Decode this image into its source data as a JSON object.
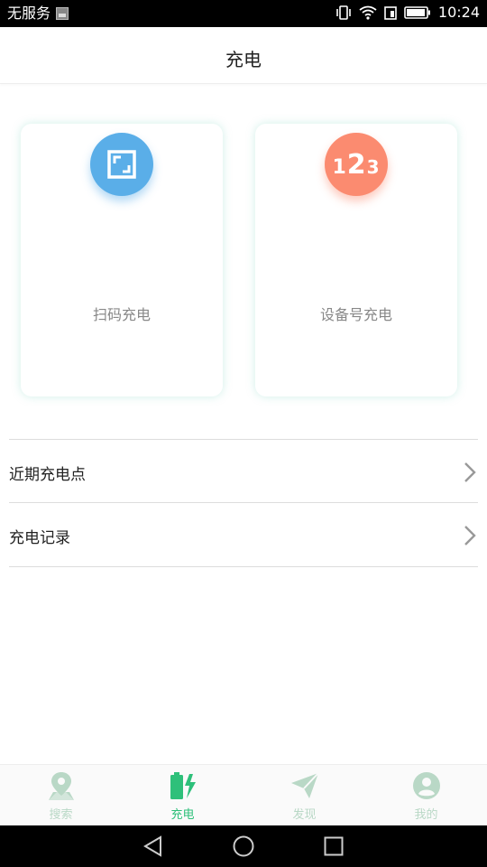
{
  "status_bar": {
    "carrier": "无服务",
    "time": "10:24"
  },
  "header": {
    "title": "充电"
  },
  "cards": [
    {
      "label": "扫码充电",
      "icon": "scan-qr-icon",
      "color": "#5aaee8"
    },
    {
      "label": "设备号充电",
      "icon": "123-number-icon",
      "color": "#fb8b70",
      "icon_text": [
        "1",
        "2",
        "3"
      ]
    }
  ],
  "list": [
    {
      "label": "近期充电点"
    },
    {
      "label": "充电记录"
    }
  ],
  "tabs": [
    {
      "label": "搜索",
      "icon": "map-pin-icon",
      "active": false
    },
    {
      "label": "充电",
      "icon": "battery-charging-icon",
      "active": true
    },
    {
      "label": "发现",
      "icon": "paper-plane-icon",
      "active": false
    },
    {
      "label": "我的",
      "icon": "user-avatar-icon",
      "active": false
    }
  ],
  "colors": {
    "accent_green": "#2ec07a",
    "inactive_tab": "#b9d8c6"
  }
}
